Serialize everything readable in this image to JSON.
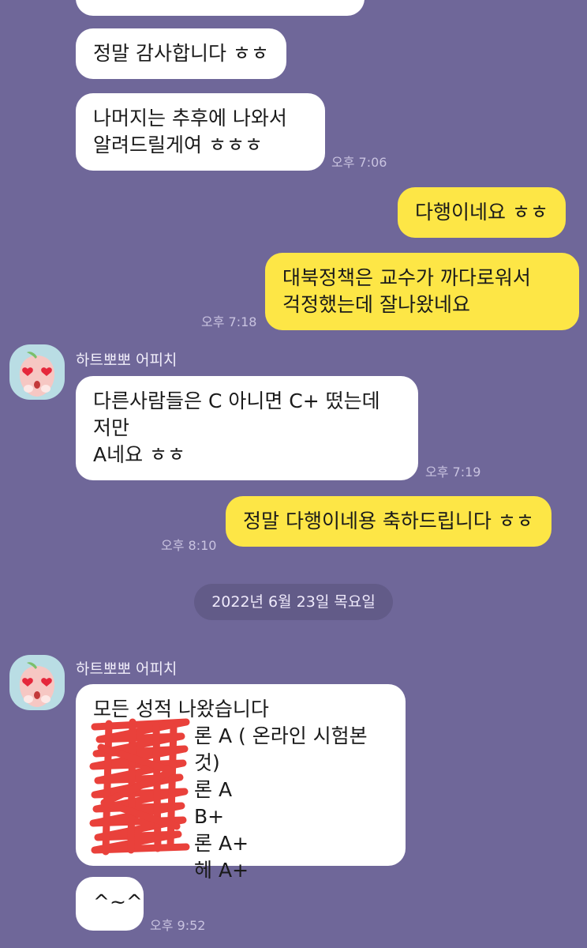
{
  "messages": {
    "m1": {
      "text": "정말 감사합니다 ㅎㅎ"
    },
    "m2": {
      "text": "나머지는 추후에 나와서\n알려드릴게여 ㅎㅎㅎ",
      "time": "오후 7:06"
    },
    "m3": {
      "text": "다행이네요 ㅎㅎ"
    },
    "m4": {
      "text": "대북정책은 교수가 까다로워서\n걱정했는데 잘나왔네요",
      "time": "오후 7:18"
    },
    "m5": {
      "sender": "하트뽀뽀 어피치",
      "text": "다른사람들은 C 아니면 C+ 떴는데\n저만\nA네요 ㅎㅎ",
      "time": "오후 7:19"
    },
    "m6": {
      "text": "정말 다행이네용 축하드립니다 ㅎㅎ",
      "time": "오후 8:10"
    },
    "date_divider": "2022년 6월 23일 목요일",
    "m7": {
      "sender": "하트뽀뽀 어피치",
      "title": "모든 성적 나왔습니다",
      "grades": [
        "A ( 온라인 시험본것)",
        "A",
        "B+",
        "A+",
        "A+"
      ],
      "grade_suffixes": [
        "론",
        "론",
        "",
        "론",
        "헤"
      ]
    },
    "m8": {
      "text": "^~^",
      "time": "오후 9:52"
    }
  },
  "colors": {
    "background": "#6f6799",
    "bubble_incoming": "#ffffff",
    "bubble_outgoing": "#fde646",
    "scribble": "#e8312b"
  },
  "icons": {
    "avatar": "apeach-heart-eyes-avatar"
  }
}
